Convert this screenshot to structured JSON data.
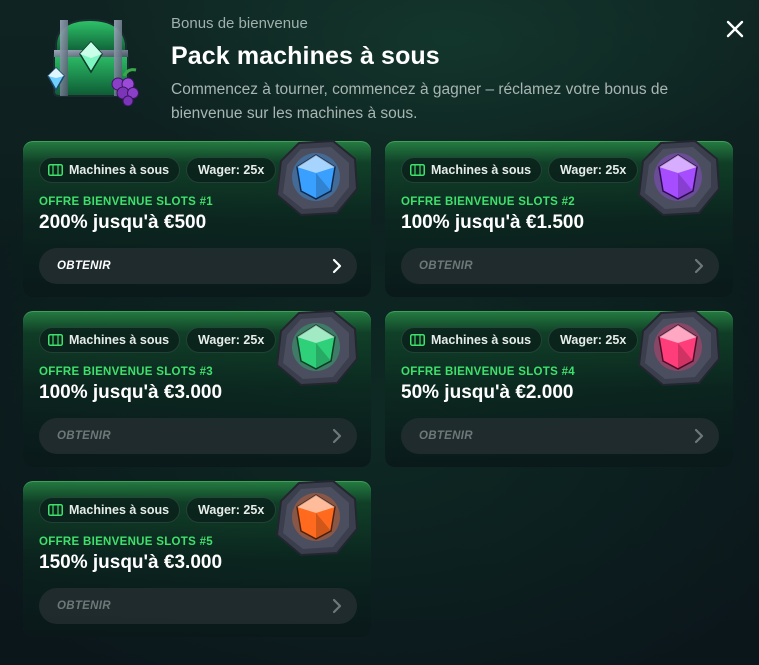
{
  "header": {
    "eyebrow": "Bonus de bienvenue",
    "title": "Pack machines à sous",
    "description": "Commencez à tourner, commencez à gagner – réclamez votre bonus de bienvenue sur les machines à sous."
  },
  "close_icon": "close-icon",
  "hero_icon": "treasure-chest-icon",
  "cards": [
    {
      "tag": "Machines à sous",
      "wager": "Wager: 25x",
      "offer": "OFFRE BIENVENUE SLOTS #1",
      "amount": "200% jusqu'à €500",
      "button": "OBTENIR",
      "active": true,
      "gem_color": "#3aa0ff"
    },
    {
      "tag": "Machines à sous",
      "wager": "Wager: 25x",
      "offer": "OFFRE BIENVENUE SLOTS #2",
      "amount": "100% jusqu'à €1.500",
      "button": "OBTENIR",
      "active": false,
      "gem_color": "#a64dff"
    },
    {
      "tag": "Machines à sous",
      "wager": "Wager: 25x",
      "offer": "OFFRE BIENVENUE SLOTS #3",
      "amount": "100% jusqu'à €3.000",
      "button": "OBTENIR",
      "active": false,
      "gem_color": "#2fd07a"
    },
    {
      "tag": "Machines à sous",
      "wager": "Wager: 25x",
      "offer": "OFFRE BIENVENUE SLOTS #4",
      "amount": "50% jusqu'à €2.000",
      "button": "OBTENIR",
      "active": false,
      "gem_color": "#ff3d7a"
    },
    {
      "tag": "Machines à sous",
      "wager": "Wager: 25x",
      "offer": "OFFRE BIENVENUE SLOTS #5",
      "amount": "150% jusqu'à €3.000",
      "button": "OBTENIR",
      "active": false,
      "gem_color": "#ff6a1f"
    }
  ],
  "colors": {
    "accent_green": "#3fe06b",
    "button_bg": "#232e30"
  }
}
